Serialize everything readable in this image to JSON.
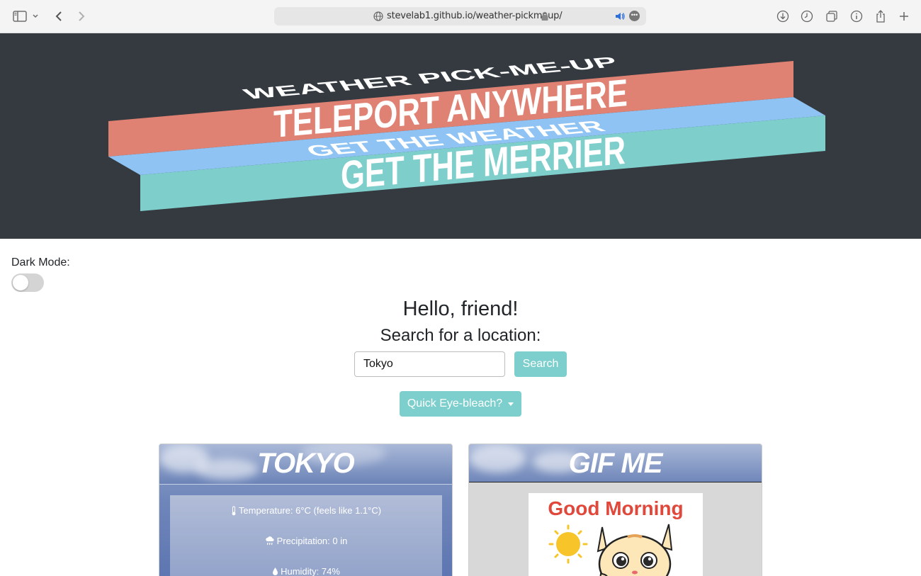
{
  "browser": {
    "url": "stevelab1.github.io/weather-pickmeup/"
  },
  "banner": {
    "line1": "WEATHER PICK-ME-UP",
    "line2": "TELEPORT ANYWHERE",
    "line3": "GET THE WEATHER",
    "line4": "GET THE MERRIER",
    "colors": {
      "background": "#343a40",
      "red": "#e08273",
      "blue": "#8ec3f4",
      "teal": "#7ecfcc"
    }
  },
  "dark_mode": {
    "label": "Dark Mode:",
    "enabled": false
  },
  "greeting": "Hello, friend!",
  "search": {
    "title": "Search for a location:",
    "value": "Tokyo",
    "button": "Search"
  },
  "eye_bleach": {
    "label": "Quick Eye-bleach?"
  },
  "weather_card": {
    "title": "TOKYO",
    "temperature": "Temperature: 6°C (feels like 1.1°C)",
    "precipitation": "Precipitation: 0 in",
    "humidity": "Humidity: 74%"
  },
  "gif_card": {
    "title": "GIF ME",
    "image_text": "Good Morning"
  },
  "accent_color": "#7ccfcc"
}
